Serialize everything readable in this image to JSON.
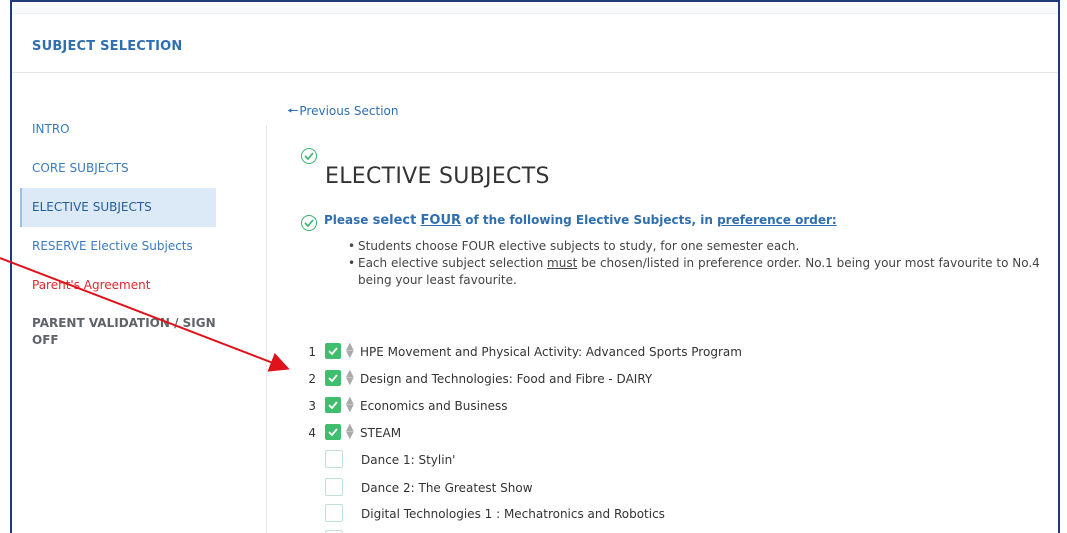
{
  "header": {
    "title": "SUBJECT SELECTION"
  },
  "sidebar": {
    "items": [
      {
        "label": "INTRO"
      },
      {
        "label": "CORE SUBJECTS"
      },
      {
        "label": "ELECTIVE SUBJECTS"
      },
      {
        "label": "RESERVE Elective Subjects"
      },
      {
        "label": "Parent's Agreement"
      },
      {
        "label": "PARENT VALIDATION / SIGN OFF"
      }
    ]
  },
  "main": {
    "prev_link": "Previous Section",
    "heading": "ELECTIVE SUBJECTS",
    "instruction": {
      "pre": "Please ",
      "select": "select",
      "four": "FOUR",
      "mid": " of the following Elective Subjects, in ",
      "pref": "preference order:"
    },
    "bullets": {
      "b1": "Students choose FOUR elective subjects to study, for one semester each.",
      "b2_pre": "Each elective subject selection ",
      "b2_must": "must",
      "b2_post": " be chosen/listed in preference order.  No.1 being your most favourite to No.4 being your least favourite."
    },
    "selected": [
      {
        "num": "1",
        "label": "HPE Movement and Physical Activity: Advanced Sports Program"
      },
      {
        "num": "2",
        "label": "Design and Technologies: Food and Fibre - DAIRY"
      },
      {
        "num": "3",
        "label": "Economics and Business"
      },
      {
        "num": "4",
        "label": "STEAM"
      }
    ],
    "options": [
      {
        "label": "Dance 1: Stylin'"
      },
      {
        "label": "Dance 2: The Greatest Show"
      },
      {
        "label": "Digital Technologies 1 : Mechatronics and Robotics"
      }
    ]
  },
  "colors": {
    "accent": "#2f6fb0",
    "check_green": "#3fbf6e",
    "annotation_arrow": "#e0121b",
    "frame": "#1f3a7a"
  },
  "icons": {
    "check": "check-icon",
    "circle_check": "circle-check-icon",
    "sort": "sort-icon",
    "arrow_left": "arrow-left-icon"
  }
}
